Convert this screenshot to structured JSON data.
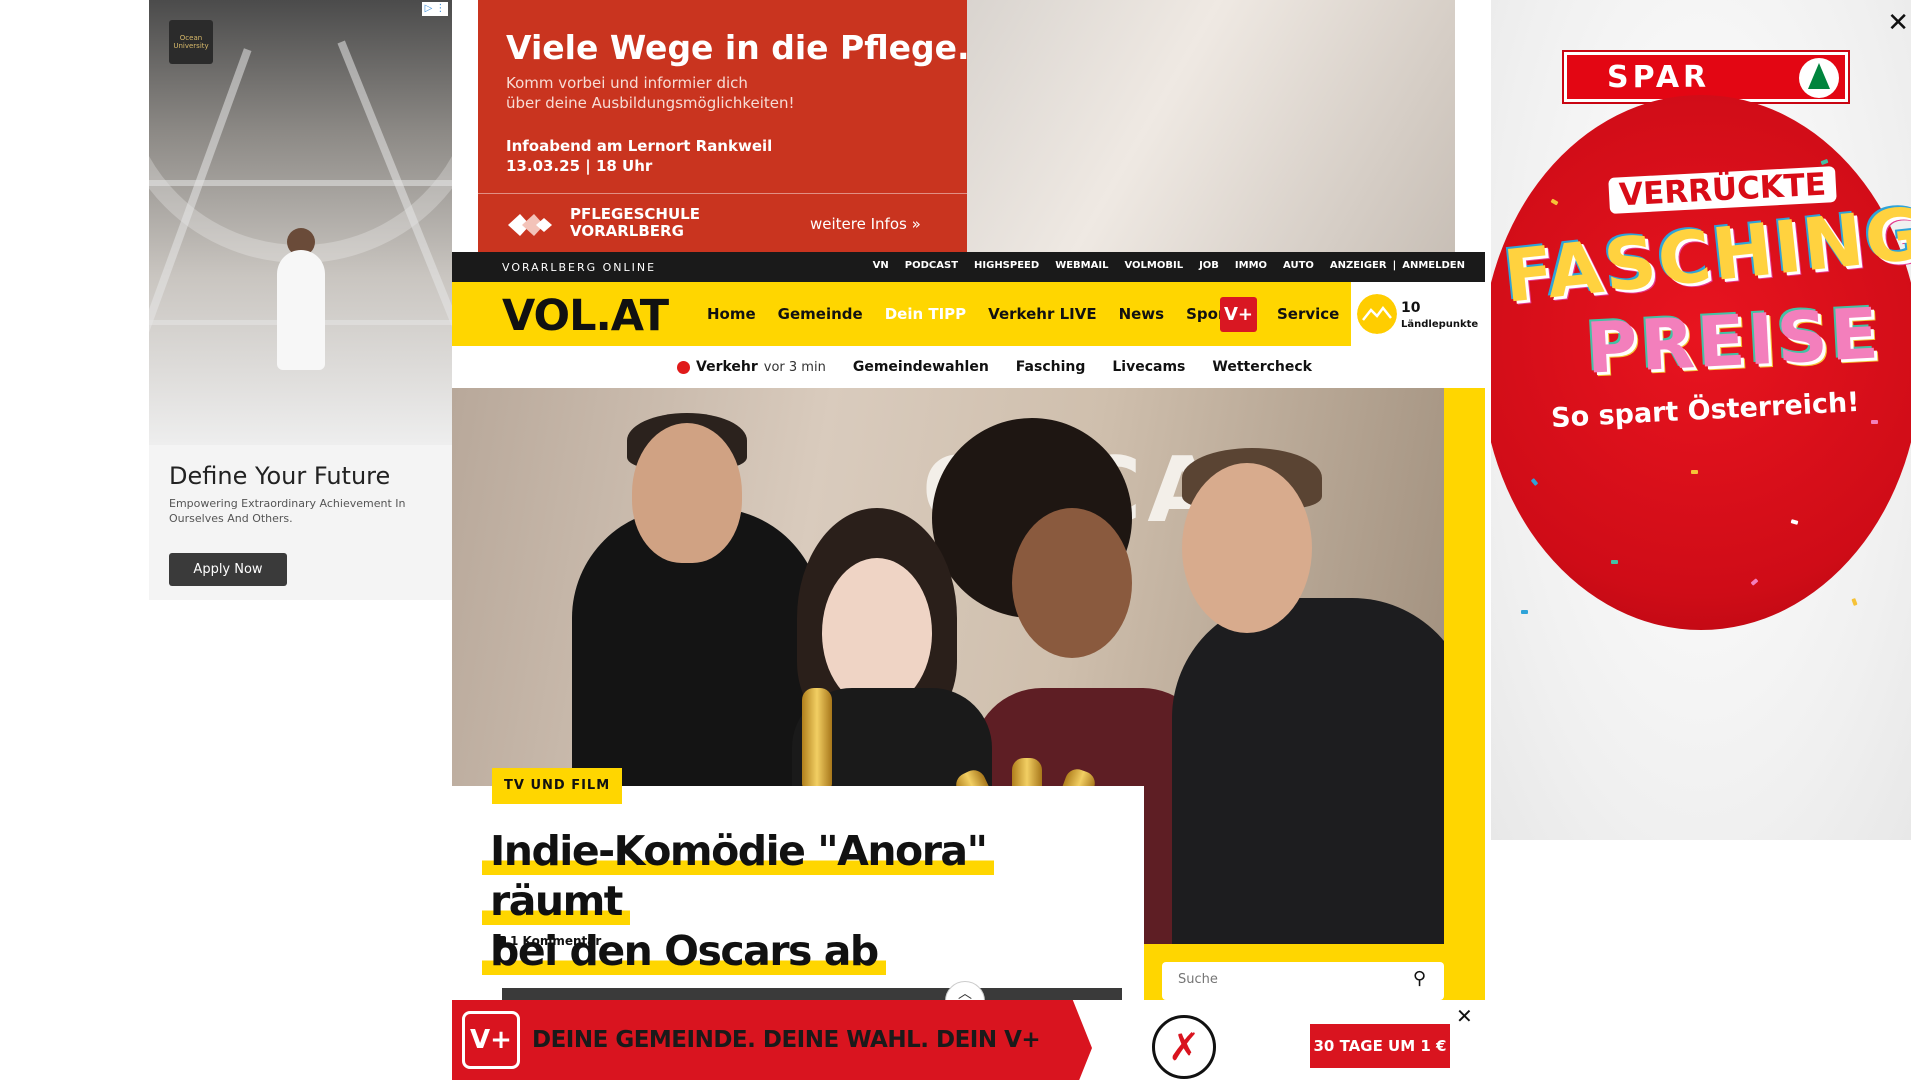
{
  "left_ad": {
    "logo_text": "Ocean University",
    "adchoices": "▷ ⋮",
    "title": "Define Your Future",
    "subtitle": "Empowering Extraordinary Achievement In Ourselves And Others.",
    "button": "Apply Now"
  },
  "top_ad": {
    "headline": "Viele Wege in die Pflege.",
    "body_line1": "Komm vorbei und informier dich",
    "body_line2": "über deine Ausbildungsmöglichkeiten!",
    "event_line1": "Infoabend am Lernort Rankweil",
    "event_line2": "13.03.25 | 18 Uhr",
    "school_line1": "PFLEGESCHULE",
    "school_line2": "VORARLBERG",
    "more_link": "weitere Infos »"
  },
  "topbar": {
    "brand": "VORARLBERG ONLINE",
    "links": [
      "VN",
      "PODCAST",
      "HIGHSPEED",
      "WEBMAIL",
      "VOLMOBIL",
      "JOB",
      "IMMO",
      "AUTO",
      "ANZEIGER",
      "|",
      "ANMELDEN"
    ]
  },
  "nav": {
    "logo": "VOL.AT",
    "items": [
      "Home",
      "Gemeinde",
      "Dein TIPP",
      "Verkehr LIVE",
      "News",
      "Sport"
    ],
    "vplus": "V+",
    "service": "Service",
    "points_value": "10",
    "points_label": "Ländlepunkte"
  },
  "subnav": {
    "live_label": "Verkehr",
    "live_time": "vor 3 min",
    "items": [
      "Gemeindewahlen",
      "Fasching",
      "Livecams",
      "Wettercheck"
    ]
  },
  "article": {
    "category": "TV UND FILM",
    "headline_line1": "Indie-Komödie \"Anora\" räumt",
    "headline_line2": "bei den Oscars ab",
    "comments": "1 Kommentar",
    "hero_wall_text": "OSCAR"
  },
  "search": {
    "placeholder": "Suche",
    "icon": "search-icon"
  },
  "right_ad": {
    "brand": "SPAR",
    "line1": "VERRÜCKTE",
    "line2": "FASCHINGS",
    "line3": "PREISE",
    "line4": "So spart Österreich!",
    "close": "✕"
  },
  "bottom_ad": {
    "badge": "V+",
    "slogan": "DEINE GEMEINDE. DEINE WAHL. DEIN V+",
    "cta": "30 TAGE UM 1 €",
    "close": "✕"
  },
  "colors": {
    "brand_yellow": "#ffd600",
    "alert_red": "#e01a1a",
    "ad_red": "#c9341f",
    "spar_red": "#e30613"
  }
}
